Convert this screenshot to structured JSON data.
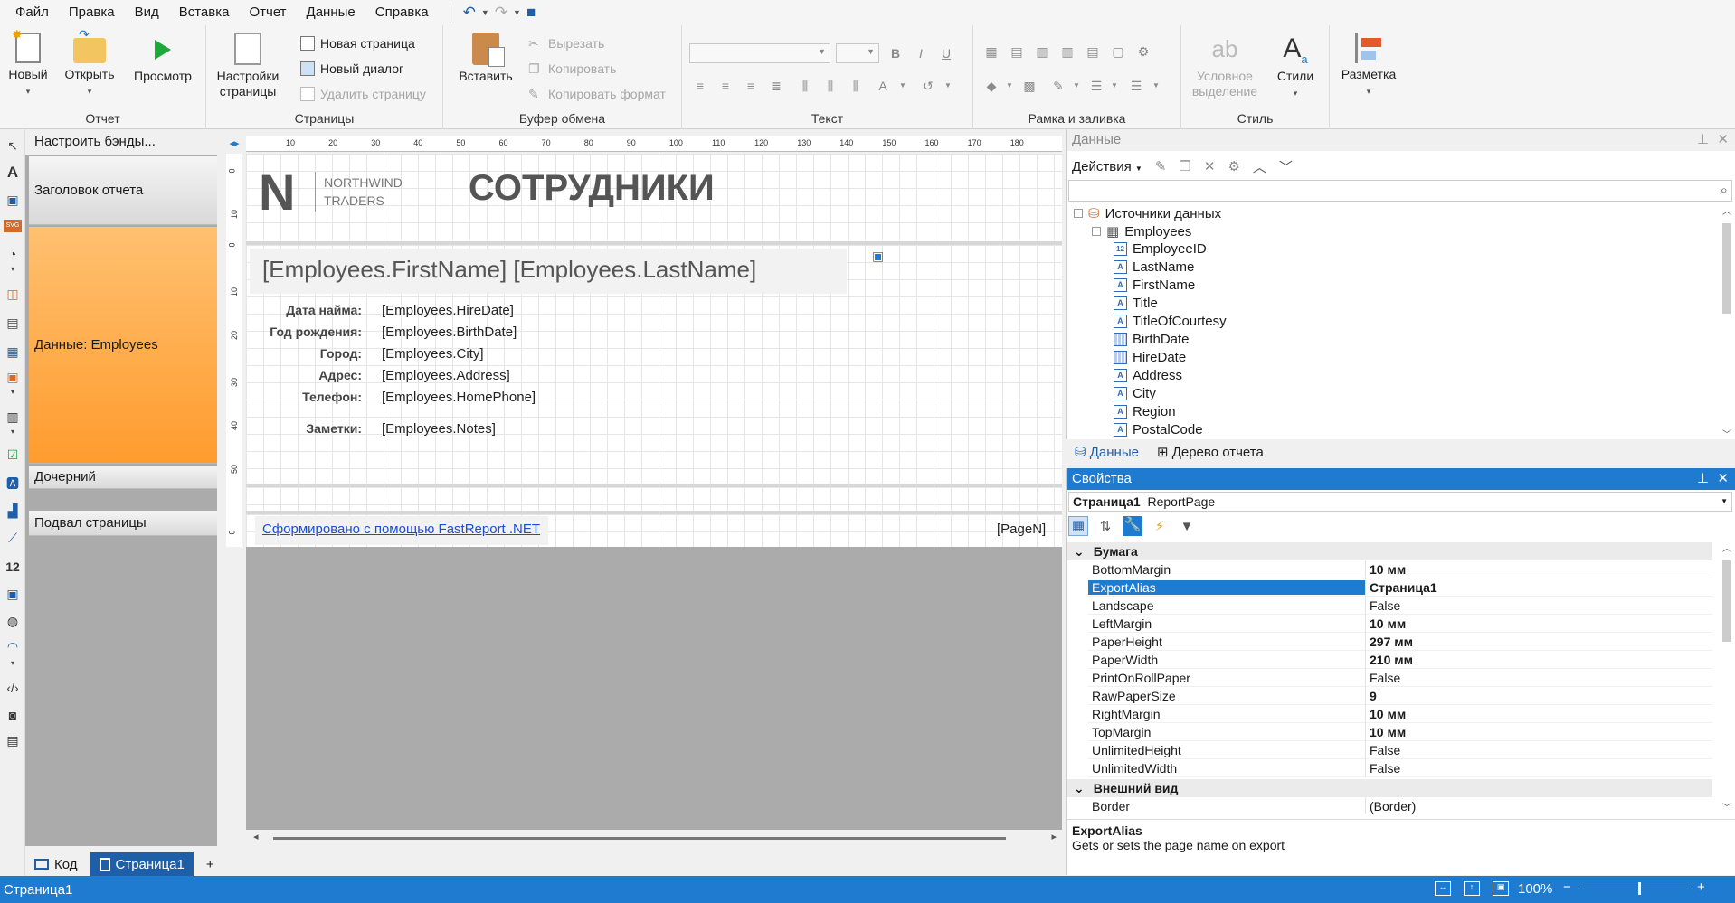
{
  "menu": [
    "Файл",
    "Правка",
    "Вид",
    "Вставка",
    "Отчет",
    "Данные",
    "Справка"
  ],
  "ribbon": {
    "report": {
      "label": "Отчет",
      "new": "Новый",
      "open": "Открыть",
      "preview": "Просмотр"
    },
    "pages": {
      "label": "Страницы",
      "settings_l1": "Настройки",
      "settings_l2": "страницы",
      "new_page": "Новая страница",
      "new_dialog": "Новый диалог",
      "delete_page": "Удалить страницу"
    },
    "clipboard": {
      "label": "Буфер обмена",
      "paste": "Вставить",
      "cut": "Вырезать",
      "copy": "Копировать",
      "copy_format": "Копировать формат"
    },
    "text": {
      "label": "Текст"
    },
    "border": {
      "label": "Рамка и заливка"
    },
    "style": {
      "label": "Стиль",
      "cond_l1": "Условное",
      "cond_l2": "выделение",
      "styles": "Стили"
    },
    "layout": {
      "label": "Разметка"
    }
  },
  "bands": {
    "configure": "Настроить бэнды...",
    "items": [
      "Заголовок отчета",
      "Данные: Employees",
      "Дочерний",
      "Подвал страницы"
    ]
  },
  "ruler": {
    "top": [
      "10",
      "20",
      "30",
      "40",
      "50",
      "60",
      "70",
      "80",
      "90",
      "100",
      "110",
      "120",
      "130",
      "140",
      "150",
      "160",
      "170",
      "180"
    ],
    "left": [
      "0",
      "10",
      "0",
      "10",
      "20",
      "30",
      "40",
      "50",
      "0"
    ]
  },
  "report": {
    "logo_letter": "N",
    "logo_line1": "NORTHWIND",
    "logo_line2": "TRADERS",
    "title": "СОТРУДНИКИ",
    "name_field": "[Employees.FirstName] [Employees.LastName]",
    "labels": [
      "Дата найма:",
      "Год рождения:",
      "Город:",
      "Адрес:",
      "Телефон:",
      "Заметки:"
    ],
    "values": [
      "[Employees.HireDate]",
      "[Employees.BirthDate]",
      "[Employees.City]",
      "[Employees.Address]",
      "[Employees.HomePhone]",
      "[Employees.Notes]"
    ],
    "footer_link": "Сформировано с помощью FastReport .NET",
    "page_n": "[PageN]"
  },
  "tabs": {
    "code": "Код",
    "page": "Страница1",
    "add": "+"
  },
  "data_panel": {
    "title": "Данные",
    "actions": "Действия",
    "root": "Источники данных",
    "table": "Employees",
    "fields": [
      {
        "name": "EmployeeID",
        "type": "12"
      },
      {
        "name": "LastName",
        "type": "A"
      },
      {
        "name": "FirstName",
        "type": "A"
      },
      {
        "name": "Title",
        "type": "A"
      },
      {
        "name": "TitleOfCourtesy",
        "type": "A"
      },
      {
        "name": "BirthDate",
        "type": "date"
      },
      {
        "name": "HireDate",
        "type": "date"
      },
      {
        "name": "Address",
        "type": "A"
      },
      {
        "name": "City",
        "type": "A"
      },
      {
        "name": "Region",
        "type": "A"
      },
      {
        "name": "PostalCode",
        "type": "A"
      }
    ],
    "tab_data": "Данные",
    "tab_tree": "Дерево отчета"
  },
  "props_panel": {
    "title": "Свойства",
    "object": "Страница1",
    "object_type": "ReportPage",
    "cat_paper": "Бумага",
    "rows": [
      {
        "name": "BottomMargin",
        "value": "10 мм",
        "bold": true
      },
      {
        "name": "ExportAlias",
        "value": "Страница1",
        "bold": true,
        "selected": true
      },
      {
        "name": "Landscape",
        "value": "False",
        "bold": false
      },
      {
        "name": "LeftMargin",
        "value": "10 мм",
        "bold": true
      },
      {
        "name": "PaperHeight",
        "value": "297 мм",
        "bold": true
      },
      {
        "name": "PaperWidth",
        "value": "210 мм",
        "bold": true
      },
      {
        "name": "PrintOnRollPaper",
        "value": "False",
        "bold": false
      },
      {
        "name": "RawPaperSize",
        "value": "9",
        "bold": true
      },
      {
        "name": "RightMargin",
        "value": "10 мм",
        "bold": true
      },
      {
        "name": "TopMargin",
        "value": "10 мм",
        "bold": true
      },
      {
        "name": "UnlimitedHeight",
        "value": "False",
        "bold": false
      },
      {
        "name": "UnlimitedWidth",
        "value": "False",
        "bold": false
      }
    ],
    "cat_appearance": "Внешний вид",
    "border_row": {
      "name": "Border",
      "value": "(Border)"
    },
    "desc_title": "ExportAlias",
    "desc_text": "Gets or sets the page name on export"
  },
  "status": {
    "page": "Страница1",
    "zoom": "100%"
  }
}
